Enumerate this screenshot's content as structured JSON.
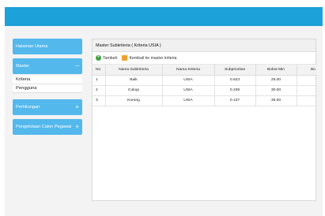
{
  "sidebar": {
    "halaman_utama": "Halaman Utama",
    "master": "Master",
    "master_toggle": "−",
    "sub_items": [
      "Kriteria",
      "Pengguna"
    ],
    "perhitungan": "Perhitungan",
    "pengelolaan": "Pengelolaan Calon Pegawai",
    "expand": "+"
  },
  "panel": {
    "title": "Master Subkriteria ( Kriteria USIA )",
    "toolbar": {
      "add_label": "Tambah",
      "back_label": "Kembali ke master kriteria"
    },
    "table": {
      "headers": [
        "No",
        "Nama Subkriteria",
        "Nama Kriteria",
        "Subprioritas",
        "Bobot Min",
        "Bo"
      ],
      "rows": [
        [
          "1",
          "Baik",
          "USIA",
          "0.623",
          "25.00",
          ""
        ],
        [
          "2",
          "Cukup",
          "USIA",
          "0.239",
          "30.00",
          ""
        ],
        [
          "3",
          "Kurang",
          "USIA",
          "0.137",
          "35.00",
          ""
        ]
      ]
    }
  }
}
